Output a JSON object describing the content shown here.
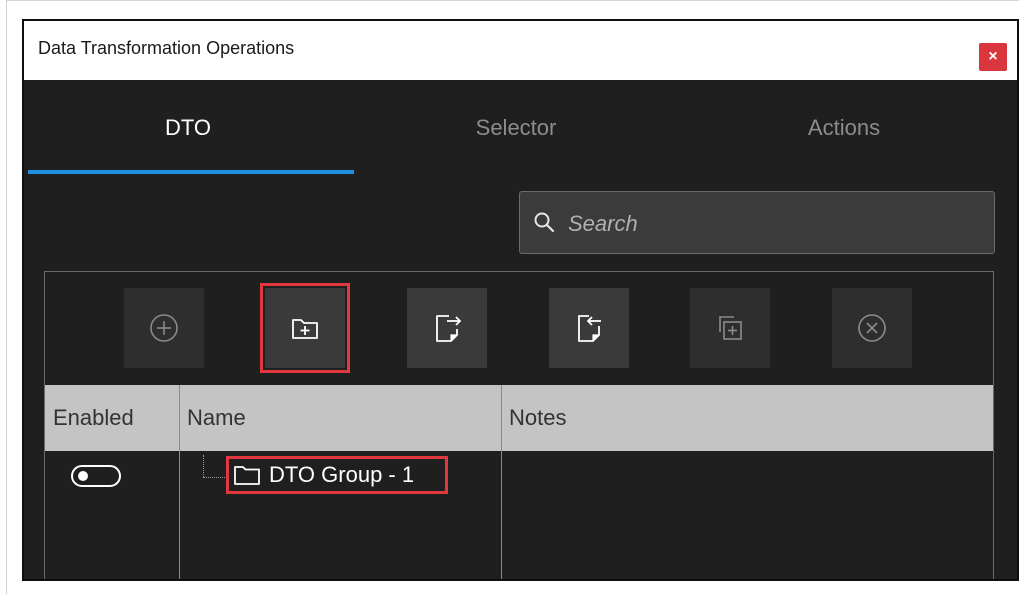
{
  "window": {
    "title": "Data Transformation Operations",
    "close_label": "×"
  },
  "tabs": [
    {
      "label": "DTO",
      "active": true
    },
    {
      "label": "Selector",
      "active": false
    },
    {
      "label": "Actions",
      "active": false
    }
  ],
  "search": {
    "placeholder": "Search"
  },
  "toolbar": {
    "buttons": [
      {
        "name": "add-dto-button",
        "icon": "plus-circle-icon",
        "enabled": false
      },
      {
        "name": "add-group-button",
        "icon": "folder-plus-icon",
        "enabled": true,
        "highlighted": true
      },
      {
        "name": "export-button",
        "icon": "file-export-icon",
        "enabled": true
      },
      {
        "name": "import-button",
        "icon": "file-import-icon",
        "enabled": true
      },
      {
        "name": "duplicate-button",
        "icon": "duplicate-icon",
        "enabled": false
      },
      {
        "name": "delete-button",
        "icon": "x-circle-icon",
        "enabled": false
      }
    ]
  },
  "grid": {
    "columns": [
      "Enabled",
      "Name",
      "Notes"
    ],
    "rows": [
      {
        "enabled": false,
        "name": "DTO Group - 1",
        "notes": "",
        "type": "folder",
        "highlighted": true
      }
    ]
  },
  "colors": {
    "accent": "#1f8fe0",
    "highlight": "#e0383e",
    "close_button": "#d9363e",
    "window_bg": "#1f1f1f",
    "header_bg": "#c4c4c4"
  }
}
